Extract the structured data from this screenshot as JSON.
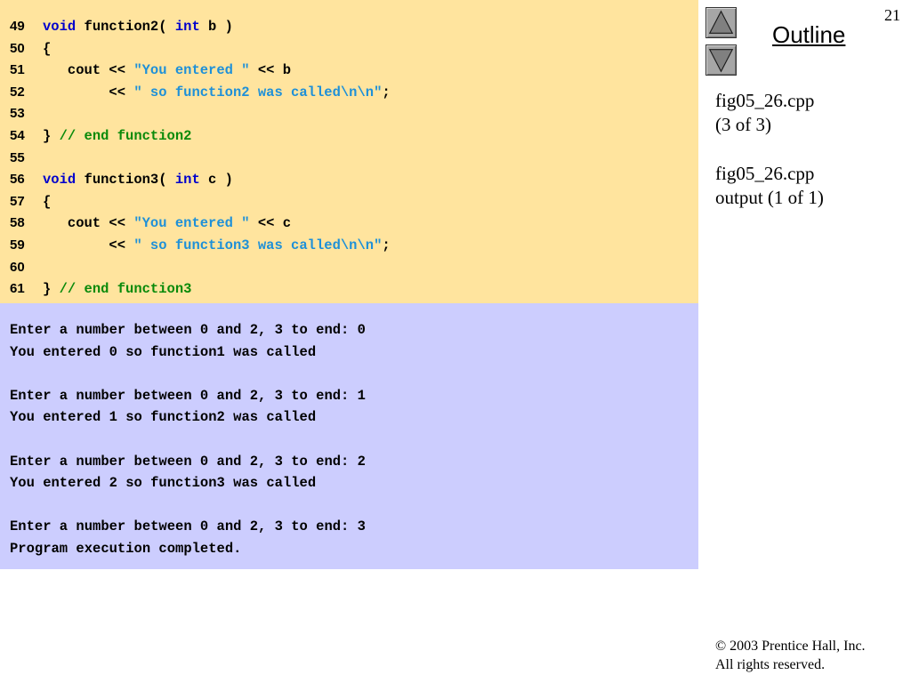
{
  "slide": {
    "page_number": "21"
  },
  "navigation": {
    "title": "Outline",
    "up_icon": "triangle-up-icon",
    "down_icon": "triangle-down-icon"
  },
  "file_info": [
    {
      "line1": "fig05_26.cpp",
      "line2": "(3 of 3)"
    },
    {
      "line1": "fig05_26.cpp",
      "line2": "output (1 of 1)"
    }
  ],
  "copyright": {
    "line1": "© 2003 Prentice Hall, Inc.",
    "line2": "All rights reserved."
  },
  "colors": {
    "code_background": "#ffe49e",
    "output_background": "#cccdfe",
    "keyword": "#0000cc",
    "string": "#1e90d8",
    "comment": "#0a8a0a",
    "plain": "#000000"
  },
  "code_lines": [
    {
      "number": "49",
      "tokens": [
        {
          "type": "keyword",
          "text": "void"
        },
        {
          "type": "plain",
          "text": " function2( "
        },
        {
          "type": "keyword",
          "text": "int"
        },
        {
          "type": "plain",
          "text": " b )"
        }
      ]
    },
    {
      "number": "50",
      "tokens": [
        {
          "type": "plain",
          "text": "{"
        }
      ]
    },
    {
      "number": "51",
      "tokens": [
        {
          "type": "plain",
          "text": "   cout << "
        },
        {
          "type": "string",
          "text": "\"You entered \""
        },
        {
          "type": "plain",
          "text": " << b"
        }
      ]
    },
    {
      "number": "52",
      "tokens": [
        {
          "type": "plain",
          "text": "        << "
        },
        {
          "type": "string",
          "text": "\" so function2 was called\\n\\n\""
        },
        {
          "type": "plain",
          "text": ";"
        }
      ]
    },
    {
      "number": "53",
      "tokens": []
    },
    {
      "number": "54",
      "tokens": [
        {
          "type": "plain",
          "text": "} "
        },
        {
          "type": "comment",
          "text": "// end function2"
        }
      ]
    },
    {
      "number": "55",
      "tokens": []
    },
    {
      "number": "56",
      "tokens": [
        {
          "type": "keyword",
          "text": "void"
        },
        {
          "type": "plain",
          "text": " function3( "
        },
        {
          "type": "keyword",
          "text": "int"
        },
        {
          "type": "plain",
          "text": " c )"
        }
      ]
    },
    {
      "number": "57",
      "tokens": [
        {
          "type": "plain",
          "text": "{"
        }
      ]
    },
    {
      "number": "58",
      "tokens": [
        {
          "type": "plain",
          "text": "   cout << "
        },
        {
          "type": "string",
          "text": "\"You entered \""
        },
        {
          "type": "plain",
          "text": " << c"
        }
      ]
    },
    {
      "number": "59",
      "tokens": [
        {
          "type": "plain",
          "text": "        << "
        },
        {
          "type": "string",
          "text": "\" so function3 was called\\n\\n\""
        },
        {
          "type": "plain",
          "text": ";"
        }
      ]
    },
    {
      "number": "60",
      "tokens": []
    },
    {
      "number": "61",
      "tokens": [
        {
          "type": "plain",
          "text": "} "
        },
        {
          "type": "comment",
          "text": "// end function3"
        }
      ]
    }
  ],
  "output_lines": [
    "Enter a number between 0 and 2, 3 to end: 0",
    "You entered 0 so function1 was called",
    "",
    "Enter a number between 0 and 2, 3 to end: 1",
    "You entered 1 so function2 was called",
    "",
    "Enter a number between 0 and 2, 3 to end: 2",
    "You entered 2 so function3 was called",
    "",
    "Enter a number between 0 and 2, 3 to end: 3",
    "Program execution completed."
  ]
}
